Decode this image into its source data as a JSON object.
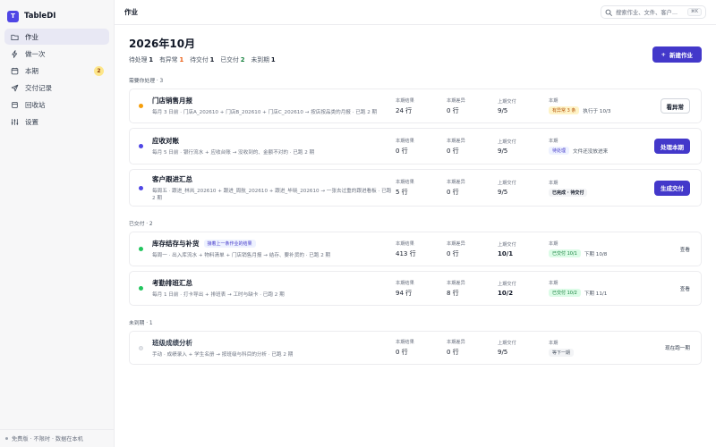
{
  "app": {
    "name": "TableDI",
    "logo_letter": "T"
  },
  "sidebar": {
    "items": [
      {
        "label": "作业",
        "icon": "folder-icon",
        "active": true
      },
      {
        "label": "做一次",
        "icon": "lightning-icon"
      },
      {
        "label": "本期",
        "icon": "calendar-icon",
        "badge": "2"
      },
      {
        "label": "交付记录",
        "icon": "send-icon"
      },
      {
        "label": "回收站",
        "icon": "trash-icon"
      },
      {
        "label": "设置",
        "icon": "sliders-icon"
      }
    ],
    "footer": "免费版 · 不限时 · 数据在本机"
  },
  "topbar": {
    "title": "作业",
    "search_placeholder": "搜索作业、文件、客户...",
    "shortcut": "⌘K"
  },
  "header": {
    "month": "2026年10月",
    "stats": [
      {
        "label": "待处理",
        "value": "1"
      },
      {
        "label": "有异常",
        "value": "1"
      },
      {
        "label": "待交付",
        "value": "1"
      },
      {
        "label": "已交付",
        "value": "2"
      },
      {
        "label": "未到期",
        "value": "1"
      }
    ],
    "new_button": "新建作业"
  },
  "metric_labels": {
    "result": "本期结果",
    "diff": "本期差异",
    "last": "上期交付",
    "period": "本期"
  },
  "sections": [
    {
      "label": "需要你处理 · 3",
      "cards": [
        {
          "name": "门店销售月报",
          "desc": "每月 3 日前 · 门店A_202610 + 门店B_202610 + 门店C_202610 → 按店按品类的月报 · 已跑 2 期",
          "result": "24 行",
          "diff": "0 行",
          "last": "9/5",
          "pill": "有异常 3 条",
          "pill_style": "orange",
          "note": "执行于 10/3",
          "action": "看异常",
          "action_style": "outline",
          "dot": "#f59e0b"
        },
        {
          "name": "应收对账",
          "desc": "每月 5 日前 · 银行流水 + 应收台账 → 没收到的、金额不对的 · 已跑 2 期",
          "result": "0 行",
          "diff": "0 行",
          "last": "9/5",
          "pill": "待处理",
          "pill_style": "indigo",
          "note": "文件还没放进来",
          "action": "处理本期",
          "action_style": "primary",
          "dot": "#4f46e5"
        },
        {
          "name": "客户跟进汇总",
          "desc": "每周五 · 跟进_林岚_202610 + 跟进_周航_202610 + 跟进_毕晓_202610 → 一张去过重的跟进看板 · 已跑 2 期",
          "result": "5 行",
          "diff": "0 行",
          "last": "9/5",
          "pill": "已完成 · 待交付",
          "pill_style": "gray",
          "note": "",
          "action": "生成交付",
          "action_style": "primary",
          "dot": "#4f46e5"
        }
      ]
    },
    {
      "label": "已交付 · 2",
      "cards": [
        {
          "name": "库存结存与补货",
          "tag": "接着上一条作业的结果",
          "desc": "每周一 · 出入库流水 + 物料清单 + 门店销售月报 → 结存、要补货的 · 已跑 2 期",
          "result": "413 行",
          "diff": "0 行",
          "last": "10/1",
          "pill": "已交付 10/1",
          "pill_style": "green",
          "note": "下期 10/8",
          "action": "查看",
          "action_style": "link",
          "dot": "#22c55e"
        },
        {
          "name": "考勤排班汇总",
          "desc": "每月 1 日前 · 打卡导出 + 排班表 → 工时与缺卡 · 已跑 2 期",
          "result": "94 行",
          "diff": "8 行",
          "last": "10/2",
          "pill": "已交付 10/2",
          "pill_style": "green",
          "note": "下期 11/1",
          "action": "查看",
          "action_style": "link",
          "dot": "#22c55e"
        }
      ]
    },
    {
      "label": "未到期 · 1",
      "cards": [
        {
          "name": "班级成绩分析",
          "desc": "手动 · 成绩录入 + 学生名册 → 按班级与科目的分析 · 已跑 2 期",
          "result": "0 行",
          "diff": "0 行",
          "last": "9/5",
          "pill": "等下一期",
          "pill_style": "gray-light",
          "note": "",
          "action": "现在跑一期",
          "action_style": "link",
          "dot": "#e5e7eb",
          "dimmed": true
        }
      ]
    }
  ],
  "colors": {
    "accent": "#4338ca",
    "warning": "#b45309",
    "success": "#15803d"
  }
}
